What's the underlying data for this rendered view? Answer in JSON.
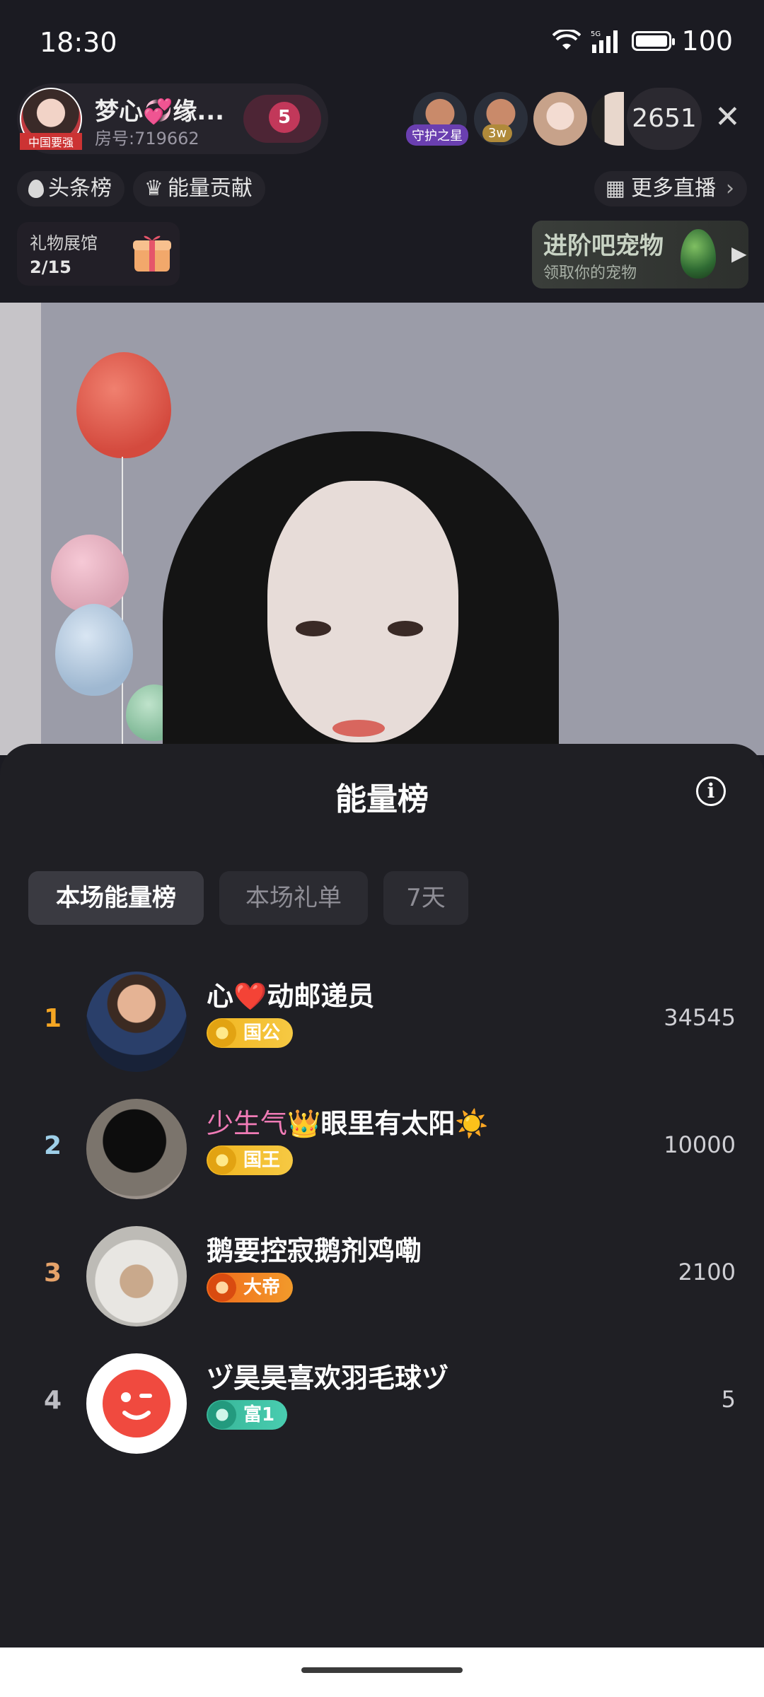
{
  "status_bar": {
    "time": "18:30",
    "network": "5G",
    "battery": "100"
  },
  "host": {
    "name": "梦心💞缘...",
    "room_id": "房号:719662",
    "avatar_tag": "中国要强",
    "heart_level": "5"
  },
  "viewers": {
    "tags": [
      "守护之星",
      "3w"
    ],
    "count": "2651"
  },
  "top_row": {
    "headline_label": "头条榜",
    "energy_label": "能量贡献",
    "more_live_label": "更多直播"
  },
  "gift_hall": {
    "label": "礼物展馆",
    "count": "2/15"
  },
  "pet_banner": {
    "title": "进阶吧宠物",
    "subtitle": "领取你的宠物"
  },
  "sheet": {
    "title": "能量榜",
    "tabs": [
      {
        "label": "本场能量榜",
        "active": true
      },
      {
        "label": "本场礼单",
        "active": false
      },
      {
        "label": "7天",
        "active": false
      }
    ],
    "rows": [
      {
        "rank": "1",
        "name": "心❤️动邮递员",
        "badge": "国公",
        "score": "34545",
        "rank_color": "#f5a623"
      },
      {
        "rank": "2",
        "name_pink": "少生气",
        "name_crown": "👑",
        "name": "眼里有太阳☀️",
        "badge": "国王",
        "score": "10000",
        "rank_color": "#9ecfe8"
      },
      {
        "rank": "3",
        "name": "鹅要控寂鹅剂鸡嘞",
        "badge": "大帝",
        "score": "2100",
        "rank_color": "#e6a36a"
      },
      {
        "rank": "4",
        "name": "ヅ昊昊喜欢羽毛球ヅ",
        "badge": "富1",
        "score": "5",
        "rank_color": "#bdbdc3"
      }
    ]
  },
  "colors": {
    "sheet_bg": "#1f1f24",
    "accent_rank1": "#f5a623",
    "badge_gold": "#f1b51f",
    "badge_orange": "#f06a1b",
    "badge_teal": "#37b497"
  },
  "icons": [
    "wifi-icon",
    "signal-icon",
    "battery-icon",
    "flame-icon",
    "crown-icon",
    "grid-icon",
    "chevron-right-icon",
    "close-icon",
    "info-icon",
    "gift-icon",
    "egg-icon"
  ]
}
